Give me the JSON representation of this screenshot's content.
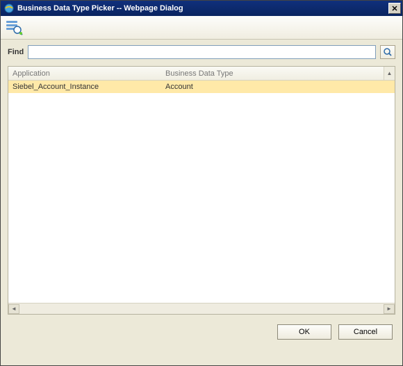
{
  "window": {
    "title": "Business Data Type Picker -- Webpage Dialog",
    "close_glyph": "✕"
  },
  "find": {
    "label": "Find",
    "value": ""
  },
  "grid": {
    "columns": {
      "application": "Application",
      "business_data_type": "Business Data Type"
    },
    "rows": [
      {
        "application": "Siebel_Account_Instance",
        "business_data_type": "Account"
      }
    ]
  },
  "buttons": {
    "ok": "OK",
    "cancel": "Cancel"
  },
  "scroll": {
    "up": "▲",
    "left": "◄",
    "right": "►"
  }
}
